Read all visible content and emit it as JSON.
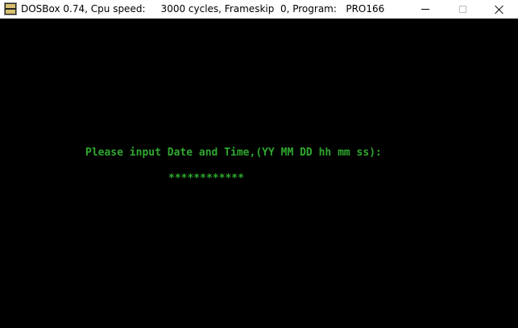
{
  "window": {
    "title": "DOSBox 0.74, Cpu speed:     3000 cycles, Frameskip  0, Program:   PRO166",
    "icon": "dosbox-icon",
    "controls": {
      "minimize": "minimize-icon",
      "maximize": "maximize-icon",
      "close": "close-icon"
    }
  },
  "console": {
    "prompt": "Please input Date and Time,(YY MM DD hh mm ss):",
    "input": "************",
    "text_color": "#2fa82f",
    "background": "#000000"
  }
}
